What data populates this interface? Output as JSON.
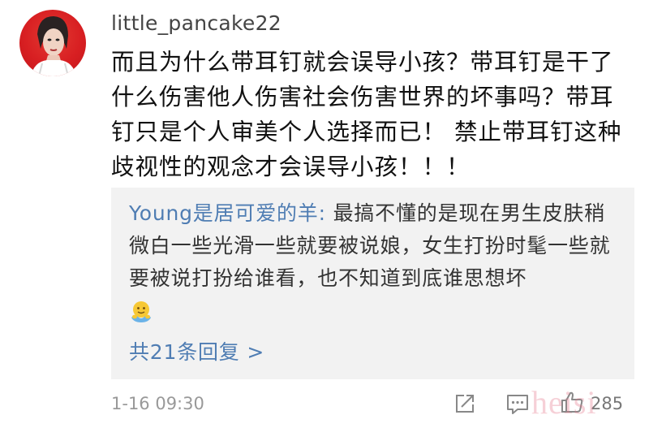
{
  "post": {
    "username": "little_pancake22",
    "comment": "而且为什么带耳钉就会误导小孩？带耳钉是干了什么伤害他人伤害社会伤害世界的坏事吗？带耳钉只是个人审美个人选择而已！ 禁止带耳钉这种歧视性的观念才会误导小孩！！！",
    "timestamp": "1-16 09:30",
    "like_count": "285",
    "watermark": "heisi"
  },
  "reply": {
    "author": "Young是居可爱的羊:",
    "text": " 最搞不懂的是现在男生皮肤稍微白一些光滑一些就要被说娘，女生打扮时髦一些就要被说打扮给谁看，也不知道到底谁思想坏",
    "emoji_icon": "hug-emoji",
    "replies_link": "共21条回复 >"
  },
  "colors": {
    "link_blue": "#4f7db3",
    "avatar_red": "#d81f22",
    "reply_bg": "#f2f2f2"
  },
  "icons": [
    "share-icon",
    "comment-icon",
    "thumbs-up-icon"
  ]
}
